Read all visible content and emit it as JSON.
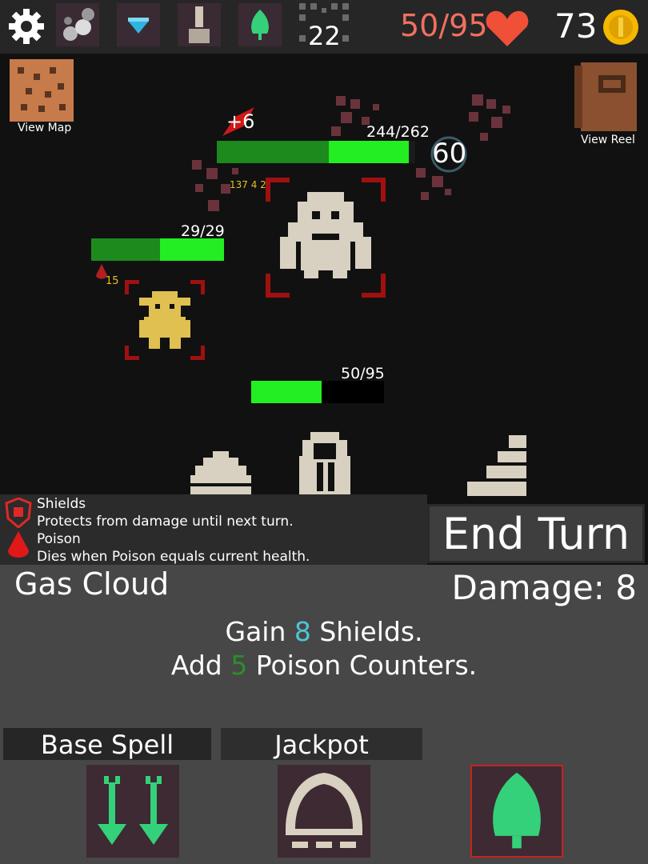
{
  "topbar": {
    "settings_icon": "gear-icon",
    "relics": [
      "balls-relic-icon",
      "gem-relic-icon",
      "sand-relic-icon",
      "leaf-relic-icon"
    ],
    "floor": "22",
    "health": "50/95",
    "gold": "73",
    "colors": {
      "health": "#f07060",
      "gold_coin": "#f5b800"
    }
  },
  "battle": {
    "view_map_label": "View Map",
    "view_reel_label": "View Reel",
    "heal_popup": "+6",
    "boss": {
      "hp_text": "244/262",
      "hp_fraction": 0.93,
      "shield": "60",
      "status_text": "137 4 2"
    },
    "goblin": {
      "hp_text": "29/29",
      "hp_fraction": 1.0,
      "poison": "15"
    },
    "player": {
      "hp_text": "50/95",
      "hp_fraction": 0.53
    }
  },
  "tooltip": {
    "items": [
      {
        "title": "Shields",
        "desc": "Protects from damage until next turn.",
        "icon": "shield-icon"
      },
      {
        "title": "Poison",
        "desc": "Dies when Poison equals current health.",
        "icon": "poison-drop-icon"
      }
    ]
  },
  "end_turn_label": "End Turn",
  "spell": {
    "name": "Gas Cloud",
    "damage": "Damage: 8",
    "line1": {
      "pre": "Gain ",
      "num": "8",
      "post": " Shields."
    },
    "line2": {
      "pre": "Add ",
      "num": "5",
      "post": " Poison Counters."
    }
  },
  "tabs": {
    "base_spell": "Base Spell",
    "jackpot": "Jackpot"
  },
  "cards": [
    "double-arrow-icon",
    "mushroom-cap-icon",
    "green-leaf-icon"
  ]
}
